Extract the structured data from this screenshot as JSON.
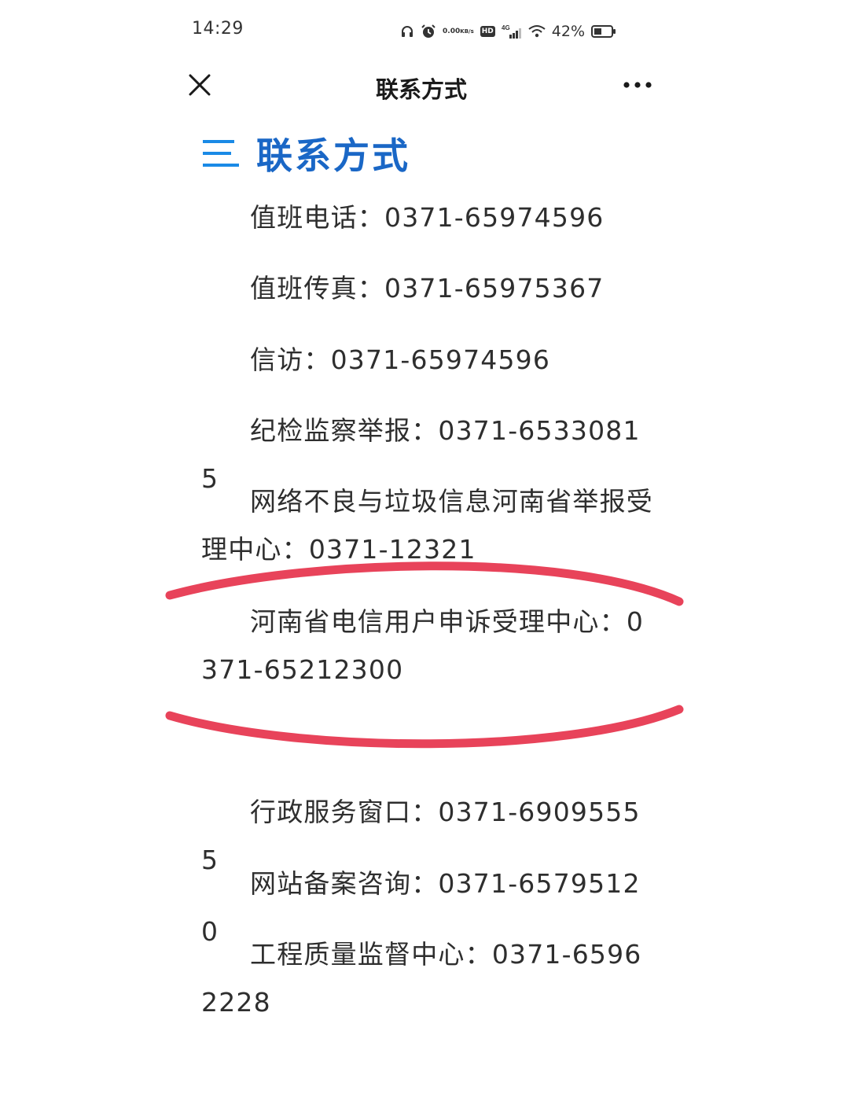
{
  "status_bar": {
    "time": "14:29",
    "net_speed_value": "0.00",
    "net_speed_unit": "KB/s",
    "hd_label": "HD",
    "network": "4G",
    "battery_percent": "42%",
    "icons": [
      "headphones-icon",
      "alarm-icon",
      "hd-icon",
      "signal-icon",
      "wifi-icon",
      "battery-icon"
    ]
  },
  "nav": {
    "title": "联系方式",
    "close_icon": "close-icon",
    "more_icon": "more-icon"
  },
  "section": {
    "icon": "menu-lines-icon",
    "heading": "联系方式",
    "accent_color": "#1a67c6"
  },
  "contacts": [
    {
      "label": "值班电话：",
      "number": "0371-65974596"
    },
    {
      "label": "值班传真：",
      "number": "0371-65975367"
    },
    {
      "label": "信访：",
      "number": "0371-65974596"
    },
    {
      "label": "纪检监察举报：",
      "number": "0371-65330815"
    },
    {
      "label": "网络不良与垃圾信息河南省举报受理中心：",
      "number": "0371-12321"
    },
    {
      "label": "河南省电信用户申诉受理中心：",
      "number": "0371-65212300"
    },
    {
      "label": "行政服务窗口：",
      "number": "0371-69095555"
    },
    {
      "label": "网站备案咨询：",
      "number": "0371-65795120"
    },
    {
      "label": "工程质量监督中心：",
      "number": "0371-65962228"
    }
  ],
  "annotation": {
    "color": "#e8435a"
  }
}
